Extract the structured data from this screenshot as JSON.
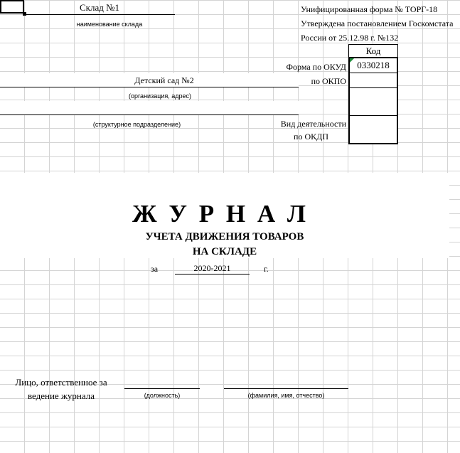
{
  "header": {
    "warehouse_name": "Склад №1",
    "warehouse_caption": "наименование склада",
    "form_line1": "Унифицированная форма № ТОРГ-18",
    "form_line2": "Утверждена постановлением Госкомстата",
    "form_line3": "России от 25.12.98 г. №132"
  },
  "org": {
    "name": "Детский сад №2",
    "org_caption": "(организация, адрес)",
    "subdivision_caption": "(структурное подразделение)"
  },
  "codes": {
    "header": "Код",
    "okud_label": "Форма по ОКУД",
    "okud_value": "0330218",
    "okpo_label": "по ОКПО",
    "okpo_value": "",
    "okdp_label_line1": "Вид деятельности",
    "okdp_label_line2": "по ОКДП",
    "okdp_value": ""
  },
  "title": {
    "main": "Ж У Р Н А Л",
    "sub1": "УЧЕТА ДВИЖЕНИЯ ТОВАРОВ",
    "sub2": "НА СКЛАДЕ",
    "period_prefix": "за",
    "period": "2020-2021",
    "period_suffix": "г."
  },
  "footer": {
    "responsible_line1": "Лицо, ответственное за",
    "responsible_line2": "ведение журнала",
    "position_caption": "(должность)",
    "name_caption": "(фамилия, имя, отчество)"
  }
}
